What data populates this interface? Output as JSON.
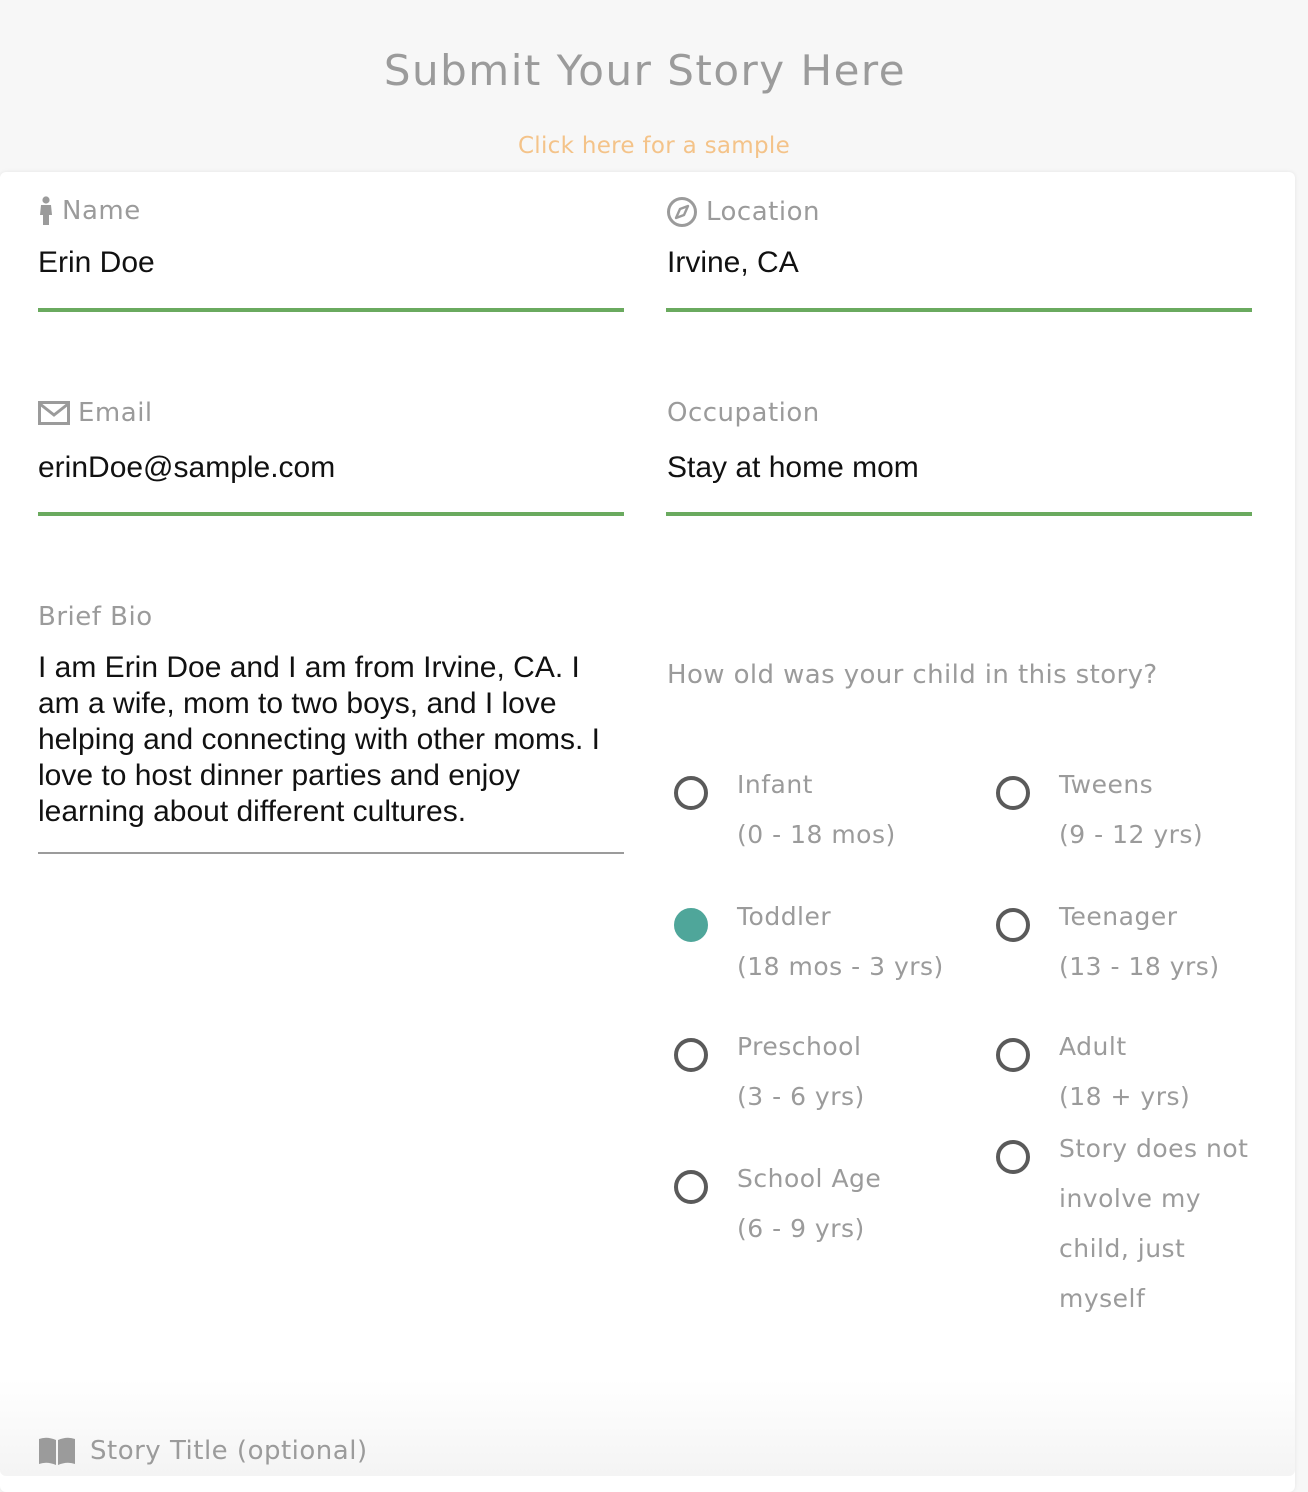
{
  "header": {
    "title": "Submit Your Story Here",
    "sample_link": "Click here for a sample"
  },
  "form": {
    "name": {
      "label": "Name",
      "icon": "person-icon",
      "value": "Erin Doe"
    },
    "location": {
      "label": "Location",
      "icon": "compass-icon",
      "value": "Irvine, CA"
    },
    "email": {
      "label": "Email",
      "icon": "envelope-icon",
      "value": "erinDoe@sample.com"
    },
    "occupation": {
      "label": "Occupation",
      "value": "Stay at home mom"
    },
    "bio": {
      "label": "Brief Bio",
      "value": "I am Erin Doe and I am from Irvine, CA. I am a wife, mom to two boys, and I love helping and connecting with other moms. I love to host dinner parties and enjoy learning about different cultures."
    },
    "age_question": {
      "label": "How old was your child in this story?",
      "options": [
        {
          "name": "Infant",
          "range": "(0 - 18 mos)",
          "checked": false
        },
        {
          "name": "Toddler",
          "range": "(18 mos - 3 yrs)",
          "checked": true
        },
        {
          "name": "Preschool",
          "range": "(3 - 6 yrs)",
          "checked": false
        },
        {
          "name": "School Age",
          "range": "(6 - 9 yrs)",
          "checked": false
        },
        {
          "name": "Tweens",
          "range": "(9 - 12 yrs)",
          "checked": false
        },
        {
          "name": "Teenager",
          "range": "(13 - 18 yrs)",
          "checked": false
        },
        {
          "name": "Adult",
          "range": "(18 + yrs)",
          "checked": false
        },
        {
          "name": "Story does not",
          "line2": "involve my",
          "line3": "child, just",
          "line4": "myself",
          "checked": false
        }
      ]
    },
    "story_title": {
      "label": "Story Title (optional)",
      "icon": "book-icon"
    }
  },
  "colors": {
    "accent_green": "#6aaa5f",
    "radio_selected": "#4fa69a",
    "link_orange": "#f4c389",
    "label_gray": "#9b9b9b"
  }
}
